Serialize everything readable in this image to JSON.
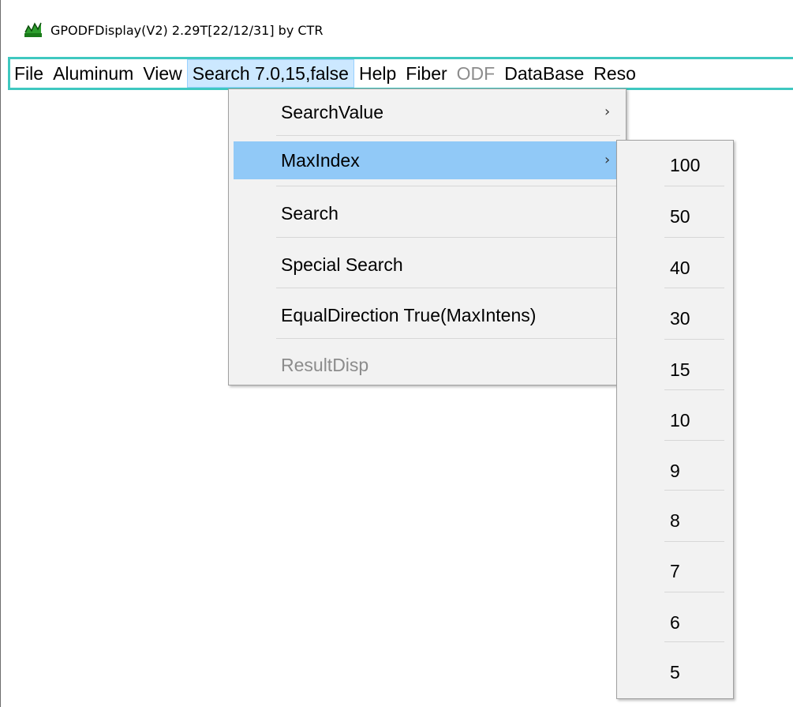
{
  "window": {
    "title": "GPODFDisplay(V2) 2.29T[22/12/31] by CTR",
    "icon": "app-icon-green-chart"
  },
  "menubar": {
    "items": [
      {
        "label": "File",
        "state": "normal"
      },
      {
        "label": "Aluminum",
        "state": "normal"
      },
      {
        "label": "View",
        "state": "normal"
      },
      {
        "label": "Search 7.0,15,false",
        "state": "open"
      },
      {
        "label": "Help",
        "state": "normal"
      },
      {
        "label": "Fiber",
        "state": "normal"
      },
      {
        "label": "ODF",
        "state": "disabled"
      },
      {
        "label": "DataBase",
        "state": "normal"
      },
      {
        "label": "Reso",
        "state": "normal"
      }
    ],
    "accent_color": "#3fc8c0"
  },
  "search_menu": {
    "items": [
      {
        "label": "SearchValue",
        "submenu_arrow": "›"
      },
      {
        "label": "MaxIndex",
        "submenu_arrow": "›"
      },
      {
        "label": "Search"
      },
      {
        "label": "Special Search"
      },
      {
        "label": "EqualDirection True(MaxIntens)"
      },
      {
        "label": "ResultDisp"
      }
    ],
    "highlight_color": "#91c9f7"
  },
  "maxindex_submenu": {
    "items": [
      "100",
      "50",
      "40",
      "30",
      "15",
      "10",
      "9",
      "8",
      "7",
      "6",
      "5"
    ]
  }
}
